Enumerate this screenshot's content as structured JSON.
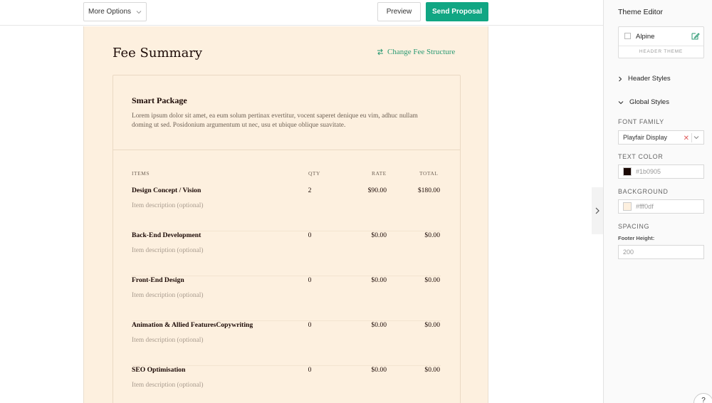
{
  "toolbar": {
    "more_options_label": "More Options",
    "preview_label": "Preview",
    "send_label": "Send Proposal",
    "send_color": "#11a683"
  },
  "document": {
    "title": "Fee Summary",
    "change_fee_label": "Change Fee Structure",
    "background": "#fdf0df",
    "package": {
      "title": "Smart Package",
      "description": "Lorem ipsum dolor sit amet, ea eum solum pertinax evertitur, vocent saperet denique eu vim, adhuc nullam doming ut sed. Posidonium argumentum ut nec, usu et ubique oblique suavitate."
    },
    "table": {
      "headers": {
        "items": "ITEMS",
        "qty": "QTY",
        "rate": "RATE",
        "total": "TOTAL"
      },
      "rows": [
        {
          "name": "Design Concept / Vision",
          "desc": "Item description (optional)",
          "qty": "2",
          "rate": "$90.00",
          "total": "$180.00"
        },
        {
          "name": "Back-End Development",
          "desc": "Item description (optional)",
          "qty": "0",
          "rate": "$0.00",
          "total": "$0.00"
        },
        {
          "name": "Front-End Design",
          "desc": "Item description (optional)",
          "qty": "0",
          "rate": "$0.00",
          "total": "$0.00"
        },
        {
          "name": "Animation & Allied FeaturesCopywriting",
          "desc": "Item description (optional)",
          "qty": "0",
          "rate": "$0.00",
          "total": "$0.00"
        },
        {
          "name": "SEO Optimisation",
          "desc": "Item description (optional)",
          "qty": "0",
          "rate": "$0.00",
          "total": "$0.00"
        }
      ]
    }
  },
  "sidebar": {
    "title": "Theme Editor",
    "theme_card": {
      "name": "Alpine",
      "label": "HEADER THEME"
    },
    "sections": {
      "header_styles": "Header Styles",
      "global_styles": "Global Styles"
    },
    "font_family": {
      "label": "FONT FAMILY",
      "value": "Playfair Display"
    },
    "text_color": {
      "label": "TEXT COLOR",
      "placeholder": "#1b0905",
      "swatch": "#1b0905"
    },
    "background": {
      "label": "BACKGROUND",
      "placeholder": "#fff0df",
      "swatch": "#fdf0df"
    },
    "spacing": {
      "label": "SPACING",
      "sublabel": "Footer Height:",
      "placeholder": "200"
    }
  },
  "help": {
    "label": "?"
  }
}
